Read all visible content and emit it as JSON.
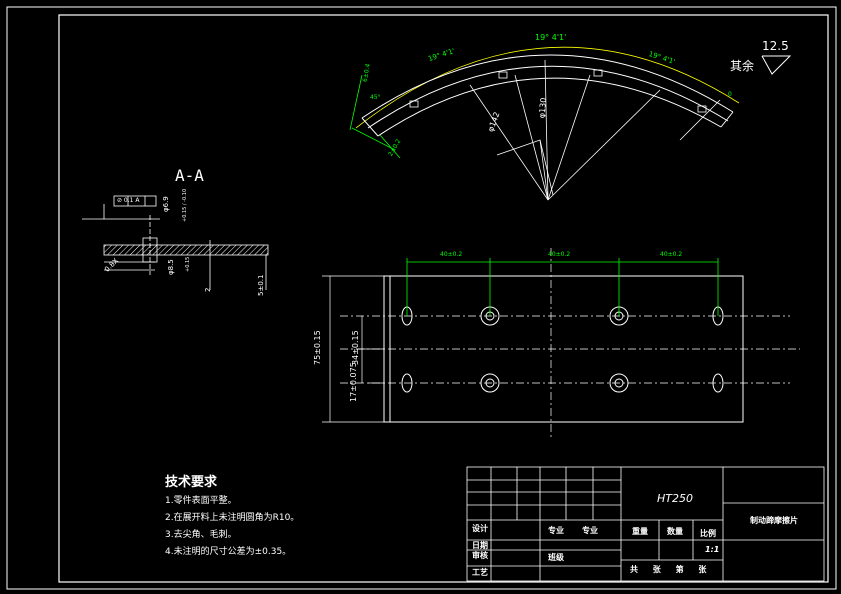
{
  "section_label": "A-A",
  "roughness": {
    "value": "12.5",
    "label": "其余"
  },
  "arc_dims": {
    "angle_center": "19° 4'1'",
    "angle_left": "19° 4'1'",
    "angle_right": "19° 4'1'",
    "diameter_outer": "φ142",
    "diameter_inner": "φ130",
    "small_left_top": "6±0.4",
    "small_left_mid": "45°",
    "small_left_bot": "2±0.2",
    "small_right": "0"
  },
  "section_dims": {
    "tol_frame": "⊘ 0.1 A",
    "hole_top": "φ6.9",
    "hole_top_tol": "+0.15 / -0.10",
    "hole_bot": "φ8.5",
    "hole_bot_tol": "+0.15",
    "chamfer": "0.8X",
    "thick_a": "2",
    "thick_b": "5±0.1"
  },
  "plan_dims": {
    "pitch_1": "40±0.2",
    "pitch_2": "40±0.2",
    "pitch_3": "40±0.2",
    "height_total": "75±0.15",
    "height_mid": "34±0.15",
    "height_low": "17±0.075"
  },
  "tech_req": {
    "title": "技术要求",
    "items": [
      "1.零件表面平整。",
      "2.在展开料上未注明圆角为R10。",
      "3.去尖角、毛刺。",
      "4.未注明的尺寸公差为±0.35。"
    ]
  },
  "title_block": {
    "material": "HT250",
    "part_name": "制动蹄摩擦片",
    "design": "设计",
    "drawing": "日期",
    "check": "审核",
    "process": "工艺",
    "major": "专业",
    "major2": "专业",
    "class": "班级",
    "weight": "重量",
    "quantity": "数量",
    "scale_label": "比例",
    "scale": "1:1",
    "sheets": "共 张 第 张"
  }
}
